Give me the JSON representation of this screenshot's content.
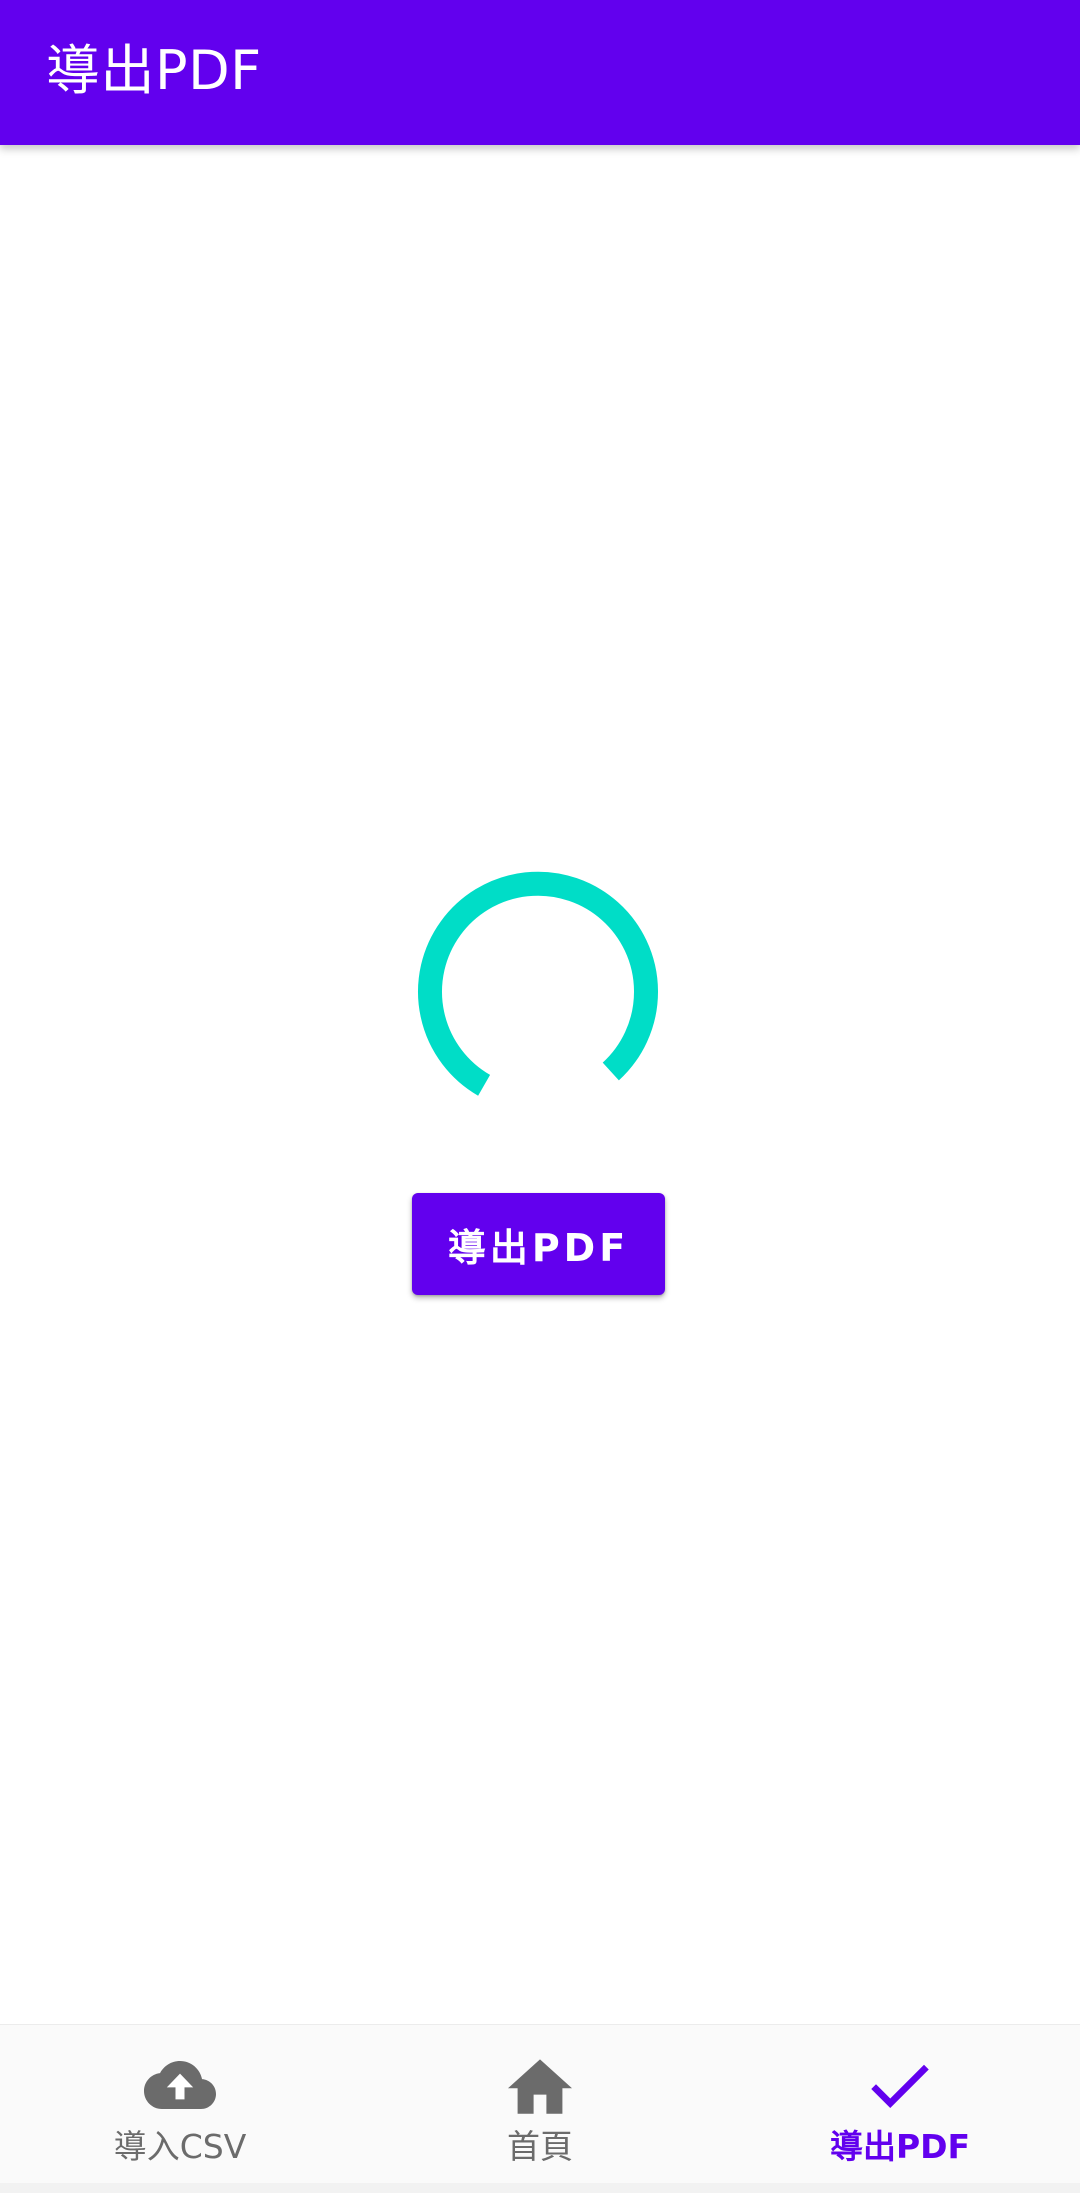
{
  "app_bar": {
    "title": "導出PDF",
    "color": "#6200EE"
  },
  "main": {
    "spinner_color": "#00DDC7",
    "export_button_label": "導出PDF"
  },
  "bottom_nav": {
    "items": [
      {
        "label": "導入CSV",
        "icon": "cloud-upload-icon",
        "active": false
      },
      {
        "label": "首頁",
        "icon": "home-icon",
        "active": false
      },
      {
        "label": "導出PDF",
        "icon": "check-icon",
        "active": true
      }
    ],
    "active_color": "#6200EE",
    "inactive_color": "#6b6b6b"
  }
}
